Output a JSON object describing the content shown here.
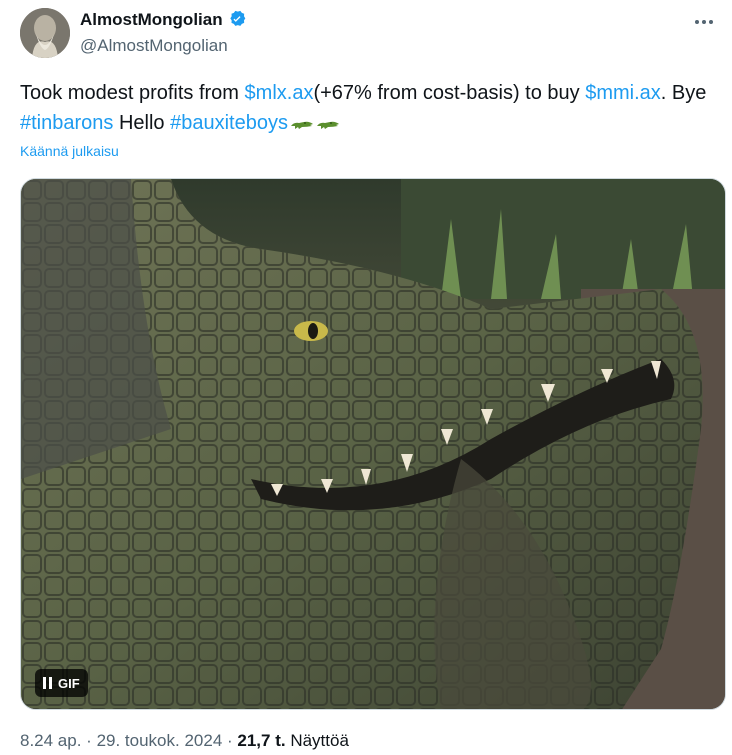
{
  "author": {
    "display_name": "AlmostMongolian",
    "handle": "@AlmostMongolian",
    "verified": true
  },
  "tweet": {
    "segments": [
      {
        "text": "Took modest profits from ",
        "type": "text"
      },
      {
        "text": "$mlx.ax",
        "type": "cashtag"
      },
      {
        "text": "(+67% from cost-basis) to buy ",
        "type": "text"
      },
      {
        "text": "$mmi.ax",
        "type": "cashtag"
      },
      {
        "text": ". Bye ",
        "type": "text"
      },
      {
        "text": "#tinbarons",
        "type": "hashtag"
      },
      {
        "text": " Hello ",
        "type": "text"
      },
      {
        "text": "#bauxiteboys",
        "type": "hashtag"
      }
    ],
    "emoji": [
      "crocodile-emoji",
      "crocodile-emoji"
    ],
    "translate_label": "Käännä julkaisu"
  },
  "media": {
    "type": "gif",
    "badge_label": "GIF",
    "description_icon": "pause-icon"
  },
  "meta": {
    "time": "8.24 ap.",
    "sep1": " · ",
    "date": "29. toukok. 2024",
    "sep2": " · ",
    "views_count": "21,7 t.",
    "views_label": " Näyttöä"
  },
  "colors": {
    "link": "#1d9bf0",
    "text": "#0f1419",
    "secondary": "#536471",
    "verified": "#1d9bf0"
  }
}
